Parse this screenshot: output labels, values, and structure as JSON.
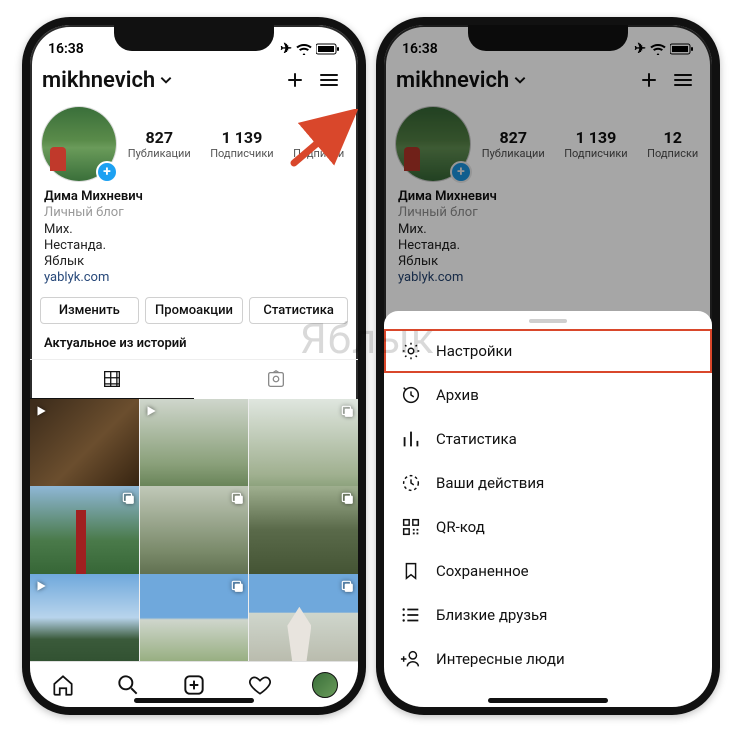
{
  "status": {
    "time": "16:38"
  },
  "header": {
    "username": "mikhnevich"
  },
  "stats": {
    "posts": {
      "num": "827",
      "label": "Публикации"
    },
    "followers": {
      "num": "1 139",
      "label": "Подписчики"
    },
    "following": {
      "num": "12",
      "label": "Подписки"
    }
  },
  "bio": {
    "name": "Дима Михневич",
    "category": "Личный блог",
    "line1": "Мих.",
    "line2": "Нестанда.",
    "line3": "Яблык",
    "link": "yablyk.com"
  },
  "buttons": {
    "edit": "Изменить",
    "promo": "Промоакции",
    "insights": "Статистика"
  },
  "highlights_title": "Актуальное из историй",
  "menu": {
    "settings": "Настройки",
    "archive": "Архив",
    "insights": "Статистика",
    "activity": "Ваши действия",
    "qr": "QR-код",
    "saved": "Сохраненное",
    "close_friends": "Близкие друзья",
    "discover": "Интересные люди"
  },
  "watermark": "Яблык"
}
